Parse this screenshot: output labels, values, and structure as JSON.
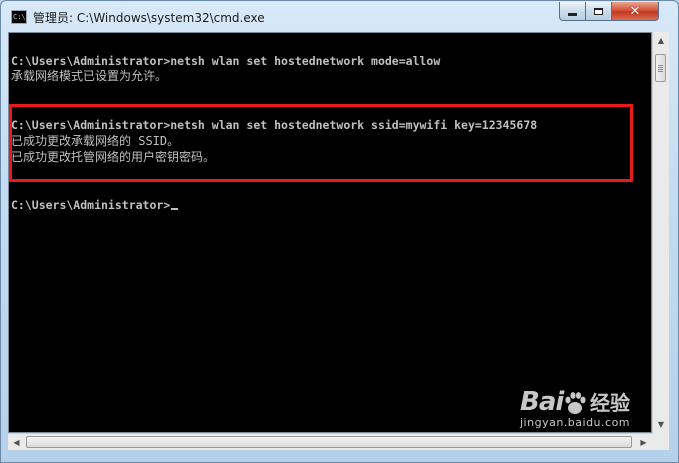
{
  "window": {
    "title": "管理员: C:\\Windows\\system32\\cmd.exe",
    "icon_label": "C:\\"
  },
  "console": {
    "lines": [
      "C:\\Users\\Administrator>netsh wlan set hostednetwork mode=allow",
      "承载网络模式已设置为允许。",
      "C:\\Users\\Administrator>netsh wlan set hostednetwork ssid=mywifi key=12345678",
      "已成功更改承载网络的 SSID。",
      "已成功更改托管网络的用户密钥密码。",
      "C:\\Users\\Administrator>"
    ],
    "text_color": "#c0c0c0",
    "background": "#000000"
  },
  "highlight": {
    "color": "#e8191b"
  },
  "watermark": {
    "logo": "Bai",
    "logo_suffix": "经验",
    "url": "jingyan.baidu.com"
  },
  "icons": {
    "minimize": "minimize-icon",
    "maximize": "maximize-icon",
    "close": "close-icon",
    "scroll_up": "arrow-up-icon",
    "scroll_down": "arrow-down-icon",
    "scroll_left": "arrow-left-icon",
    "scroll_right": "arrow-right-icon"
  }
}
